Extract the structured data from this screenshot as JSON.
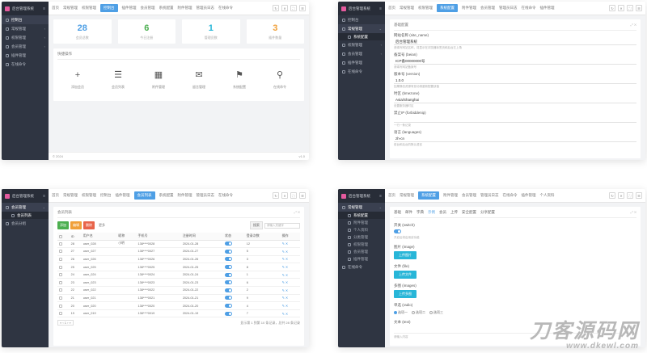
{
  "common": {
    "brand": "后台管理系统",
    "toggle": "≡",
    "topbar_icons": [
      "↻",
      "✕",
      "⛶",
      "☰"
    ],
    "card_tools": "⤢  ✕",
    "footer_left": "© 2024",
    "footer_right": "v1.0"
  },
  "panel1": {
    "menu": [
      "控制台",
      "常规管理",
      "权限管理",
      "会员管理",
      "插件管理",
      "在线命令"
    ],
    "tabs": [
      "首页",
      "常规管理",
      "权限管理",
      "控制台",
      "插件管理",
      "会员管理",
      "系统配置",
      "附件管理",
      "管理员日志",
      "在线命令"
    ],
    "stats": [
      {
        "value": "28",
        "label": "会员总数",
        "color": "#4e9fe5"
      },
      {
        "value": "6",
        "label": "今日注册",
        "color": "#4caf50"
      },
      {
        "value": "1",
        "label": "管理员数",
        "color": "#28b6d8"
      },
      {
        "value": "3",
        "label": "插件数量",
        "color": "#f0a03a"
      }
    ],
    "shortcuts_title": "快捷操作",
    "shortcuts": [
      {
        "icon": "+",
        "name": "plus-icon",
        "label": "添加会员"
      },
      {
        "icon": "☰",
        "name": "list-icon",
        "label": "会员列表"
      },
      {
        "icon": "▦",
        "name": "image-icon",
        "label": "附件管理"
      },
      {
        "icon": "✉",
        "name": "message-icon",
        "label": "留言管理"
      },
      {
        "icon": "⚑",
        "name": "flag-icon",
        "label": "系统配置"
      },
      {
        "icon": "⚲",
        "name": "link-icon",
        "label": "在线命令"
      }
    ]
  },
  "panel2": {
    "menu": [
      "控制台",
      "常规管理",
      "系统配置",
      "权限管理",
      "会员管理",
      "插件管理",
      "在线命令"
    ],
    "tabs": [
      "首页",
      "常规管理",
      "权限管理",
      "系统配置",
      "附件管理",
      "会员管理",
      "管理员日志",
      "在线命令",
      "插件管理"
    ],
    "card_title": "基础配置",
    "fields": [
      {
        "label": "网站名称 (site_name)",
        "value": "后台管理系统",
        "hint": "请填写网站名称，将显示在浏览器标签页和后台左上角"
      },
      {
        "label": "备案号 (beian)",
        "value": "ICP备00000000号",
        "hint": "请填写网站备案号"
      },
      {
        "label": "版本号 (version)",
        "value": "1.0.0",
        "hint": "如果静态资源有变动请重新配置该值"
      },
      {
        "label": "时区 (timezone)",
        "value": "Asia/Shanghai",
        "hint": "设置服务器时区"
      },
      {
        "label": "禁止IP (forbiddenip)",
        "value": "",
        "hint": "一行一条记录"
      },
      {
        "label": "语言 (languages)",
        "value": "zh-cn",
        "hint": "前台和后台的默认语言"
      }
    ]
  },
  "panel3": {
    "menu": [
      "会员管理",
      "会员列表",
      "会员分组"
    ],
    "tabs": [
      "首页",
      "常规管理",
      "权限管理",
      "控制台",
      "插件管理",
      "会员列表",
      "系统配置",
      "附件管理",
      "管理员日志",
      "在线命令"
    ],
    "card_title": "会员列表",
    "buttons": {
      "add": "添加",
      "edit": "编辑",
      "del": "删除",
      "more": "更多"
    },
    "search_btn": "搜索",
    "search_placeholder": "请输入关键字",
    "columns": [
      "",
      "ID",
      "用户名",
      "昵称",
      "手机号",
      "注册时间",
      "状态",
      "登录次数",
      "操作"
    ],
    "rows": [
      [
        "28",
        "user_028",
        "小明",
        "138****0028",
        "2024-01-28",
        "正常",
        "12"
      ],
      [
        "27",
        "user_027",
        "",
        "138****0027",
        "2024-01-27",
        "正常",
        "5"
      ],
      [
        "26",
        "user_026",
        "",
        "138****0026",
        "2024-01-26",
        "正常",
        "3"
      ],
      [
        "25",
        "user_025",
        "",
        "138****0025",
        "2024-01-25",
        "正常",
        "8"
      ],
      [
        "24",
        "user_024",
        "",
        "138****0024",
        "2024-01-24",
        "正常",
        "1"
      ],
      [
        "23",
        "user_023",
        "",
        "138****0023",
        "2024-01-23",
        "正常",
        "6"
      ],
      [
        "22",
        "user_022",
        "",
        "138****0022",
        "2024-01-22",
        "正常",
        "2"
      ],
      [
        "21",
        "user_021",
        "",
        "138****0021",
        "2024-01-21",
        "正常",
        "9"
      ],
      [
        "20",
        "user_020",
        "",
        "138****0020",
        "2024-01-20",
        "正常",
        "4"
      ],
      [
        "19",
        "user_019",
        "",
        "138****0019",
        "2024-01-19",
        "正常",
        "7"
      ]
    ],
    "row_action": "✎ ✕",
    "pager_left": "« ‹ 1 › »",
    "pager_right": "显示第 1 到第 10 条记录，总共 28 条记录"
  },
  "panel4": {
    "menu": [
      "常规管理",
      "系统配置",
      "附件管理",
      "个人资料",
      "分类管理",
      "权限管理",
      "会员管理",
      "插件管理",
      "在线命令"
    ],
    "tabs": [
      "首页",
      "常规管理",
      "系统配置",
      "附件管理",
      "会员管理",
      "管理员日志",
      "在线命令",
      "插件管理",
      "个人资料"
    ],
    "inner_tabs": [
      "基础",
      "邮件",
      "字典",
      "示例",
      "会员",
      "上传",
      "安全配置",
      "分享配置"
    ],
    "switch_label": "开关 (switch)",
    "switch_hint": "开启后将启用该功能",
    "upload_items": [
      {
        "label": "图片 (image)",
        "button": "上传图片"
      },
      {
        "label": "文件 (file)",
        "button": "上传文件"
      },
      {
        "label": "多图 (images)",
        "button": "上传多图"
      }
    ],
    "radio_label": "单选 (radio)",
    "radios": [
      "选项一",
      "选项二",
      "选项三"
    ],
    "text_label": "文本 (text)",
    "text_hint": "请输入内容"
  },
  "watermark": {
    "cn": "刀客源码网",
    "en": "www.dkewl.com"
  }
}
